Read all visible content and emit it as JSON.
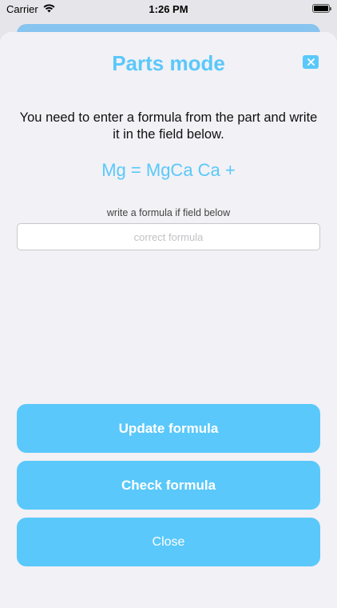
{
  "status_bar": {
    "carrier": "Carrier",
    "time": "1:26 PM"
  },
  "header": {
    "title": "Parts mode",
    "close_icon": "close-icon"
  },
  "content": {
    "instruction": "You need to enter a formula from the part and write it in the field below.",
    "formula": "Mg = MgCa Ca +",
    "hint": "write a formula if field below",
    "input_placeholder": "correct formula",
    "input_value": ""
  },
  "actions": {
    "update_label": "Update formula",
    "check_label": "Check formula",
    "close_label": "Close"
  },
  "colors": {
    "accent": "#5ac8fa",
    "sheet_bg": "#f1f1f6"
  }
}
